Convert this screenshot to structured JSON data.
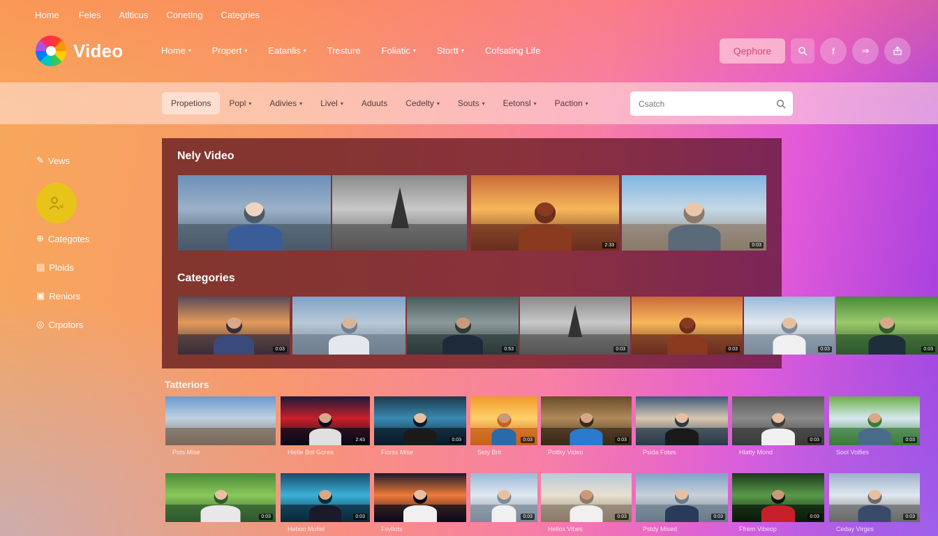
{
  "topnav": [
    "Home",
    "Feles",
    "Atlticus",
    "Conetlng",
    "Categries"
  ],
  "brand": {
    "name": "Video"
  },
  "mainnav": [
    {
      "label": "Home",
      "caret": true
    },
    {
      "label": "Propert",
      "caret": true
    },
    {
      "label": "Eatanlis",
      "caret": true
    },
    {
      "label": "Tresture",
      "caret": false
    },
    {
      "label": "Foliatic",
      "caret": true
    },
    {
      "label": "Stortt",
      "caret": true
    },
    {
      "label": "Cofsating Life",
      "caret": false
    }
  ],
  "header_actions": {
    "cta_label": "Qephore",
    "search_icon": "search-icon",
    "icons": [
      "facebook-icon",
      "share-icon",
      "upload-icon"
    ],
    "icon_text": [
      "f",
      "⇒",
      ""
    ]
  },
  "filters": [
    {
      "label": "Propetions",
      "caret": false,
      "active": true
    },
    {
      "label": "Popl",
      "caret": true
    },
    {
      "label": "Adivies",
      "caret": true
    },
    {
      "label": "Livel",
      "caret": true
    },
    {
      "label": "Aduuts",
      "caret": false
    },
    {
      "label": "Cedelty",
      "caret": true
    },
    {
      "label": "Souts",
      "caret": true
    },
    {
      "label": "Eetonsl",
      "caret": true
    },
    {
      "label": "Paction",
      "caret": true
    }
  ],
  "search": {
    "placeholder": "Csatch"
  },
  "sidebar": {
    "items": [
      {
        "label": "Vews",
        "icon": "pencil-icon"
      },
      {
        "label": "Categotes",
        "icon": "grid-icon"
      },
      {
        "label": "Ploids",
        "icon": "list-icon"
      },
      {
        "label": "Reniors",
        "icon": "folder-icon"
      },
      {
        "label": "Crpotors",
        "icon": "compass-icon"
      }
    ]
  },
  "panel": {
    "new_title": "Nely Video",
    "new_videos": [
      {
        "scene": "city-woman",
        "badge": ""
      },
      {
        "scene": "eiffel-mono",
        "badge": ""
      },
      {
        "scene": "street-sunset",
        "badge": "2:33"
      },
      {
        "scene": "hiker-town",
        "badge": "0:03"
      }
    ],
    "categories_title": "Categories",
    "categories": [
      {
        "scene": "sunset-woman",
        "badge": "0:03"
      },
      {
        "scene": "city-woman-2",
        "badge": ""
      },
      {
        "scene": "man-alley",
        "badge": "0:53"
      },
      {
        "scene": "eiffel-mono",
        "badge": "0:03"
      },
      {
        "scene": "street-sunset",
        "badge": "0:03"
      },
      {
        "scene": "woman-mountain",
        "badge": "0:03"
      },
      {
        "scene": "man-forest",
        "badge": "0:03"
      }
    ]
  },
  "grid": {
    "title": "Tatteriors",
    "row1": [
      {
        "label": "Pots Mise",
        "badge": "",
        "scene": "bridge"
      },
      {
        "label": "Hielle Bot Gorea",
        "badge": "2:43",
        "scene": "man-stage"
      },
      {
        "label": "Fiorss Mise",
        "badge": "0:03",
        "scene": "woman-stage"
      },
      {
        "label": "Sety Brit",
        "badge": "0:03",
        "scene": "man-orange"
      },
      {
        "label": "Pottky Video",
        "badge": "0:03",
        "scene": "man-library"
      },
      {
        "label": "Psida Fotes",
        "badge": "",
        "scene": "woman-window"
      },
      {
        "label": "Hlatty Mond",
        "badge": "0:03",
        "scene": "woman-grey"
      },
      {
        "label": "Sool Volfies",
        "badge": "0:03",
        "scene": "man-park"
      }
    ],
    "row2": [
      {
        "label": "",
        "badge": "0:03",
        "scene": "woman-forest"
      },
      {
        "label": "Heboo Mofiel",
        "badge": "0:03",
        "scene": "couple-neon"
      },
      {
        "label": "Fsvllots",
        "badge": "",
        "scene": "woman-sunburst"
      },
      {
        "label": "",
        "badge": "0:03",
        "scene": "woman-mountain"
      },
      {
        "label": "Hellox Vibes",
        "badge": "0:03",
        "scene": "man-beach"
      },
      {
        "label": "Pstdy Mised",
        "badge": "0:03",
        "scene": "woman-city"
      },
      {
        "label": "Ffrem Vibeop",
        "badge": "0:03",
        "scene": "man-green"
      },
      {
        "label": "Ceday Virges",
        "badge": "0:03",
        "scene": "woman-bridge"
      }
    ]
  },
  "colors": {
    "accent": "#e8c31a",
    "cta_text": "#d64a79",
    "panel": "#7a2d2a"
  }
}
